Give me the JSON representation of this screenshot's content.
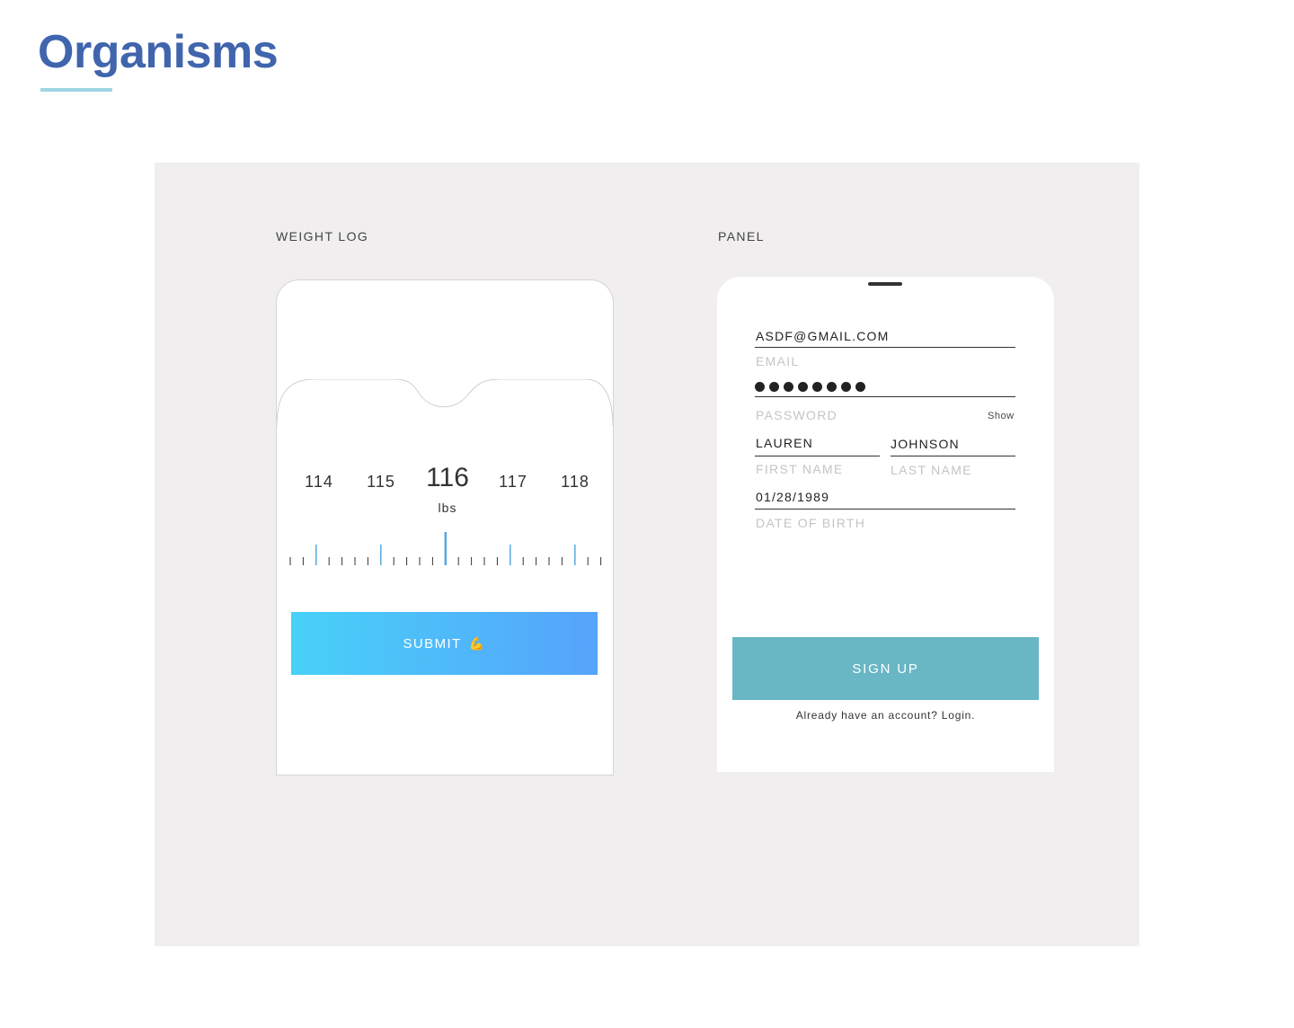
{
  "page": {
    "title": "Organisms"
  },
  "colors": {
    "title": "#4065ad",
    "underline": "#9fd5e6",
    "canvas_bg": "#f0eeee",
    "ruler_accent": "#56a8e0",
    "submit_gradient_start": "#48d1f8",
    "submit_gradient_end": "#56a3fb",
    "signup_bg": "#69b6c4"
  },
  "weight_log": {
    "label": "WEIGHT LOG",
    "scale": {
      "values": [
        "114",
        "115",
        "116",
        "117",
        "118"
      ],
      "selected": "116",
      "unit": "lbs"
    },
    "submit_label": "SUBMIT",
    "submit_icon": "flexed-biceps-icon"
  },
  "panel": {
    "label": "PANEL",
    "email": {
      "value": "ASDF@GMAIL.COM",
      "label": "EMAIL"
    },
    "password": {
      "masked_length": 8,
      "label": "PASSWORD",
      "show_label": "Show"
    },
    "first_name": {
      "value": "LAUREN",
      "label": "FIRST NAME"
    },
    "last_name": {
      "value": "JOHNSON",
      "label": "LAST NAME"
    },
    "dob": {
      "value": "01/28/1989",
      "label": "DATE OF BIRTH"
    },
    "signup_label": "SIGN UP",
    "login_prompt": "Already have an account? Login."
  }
}
